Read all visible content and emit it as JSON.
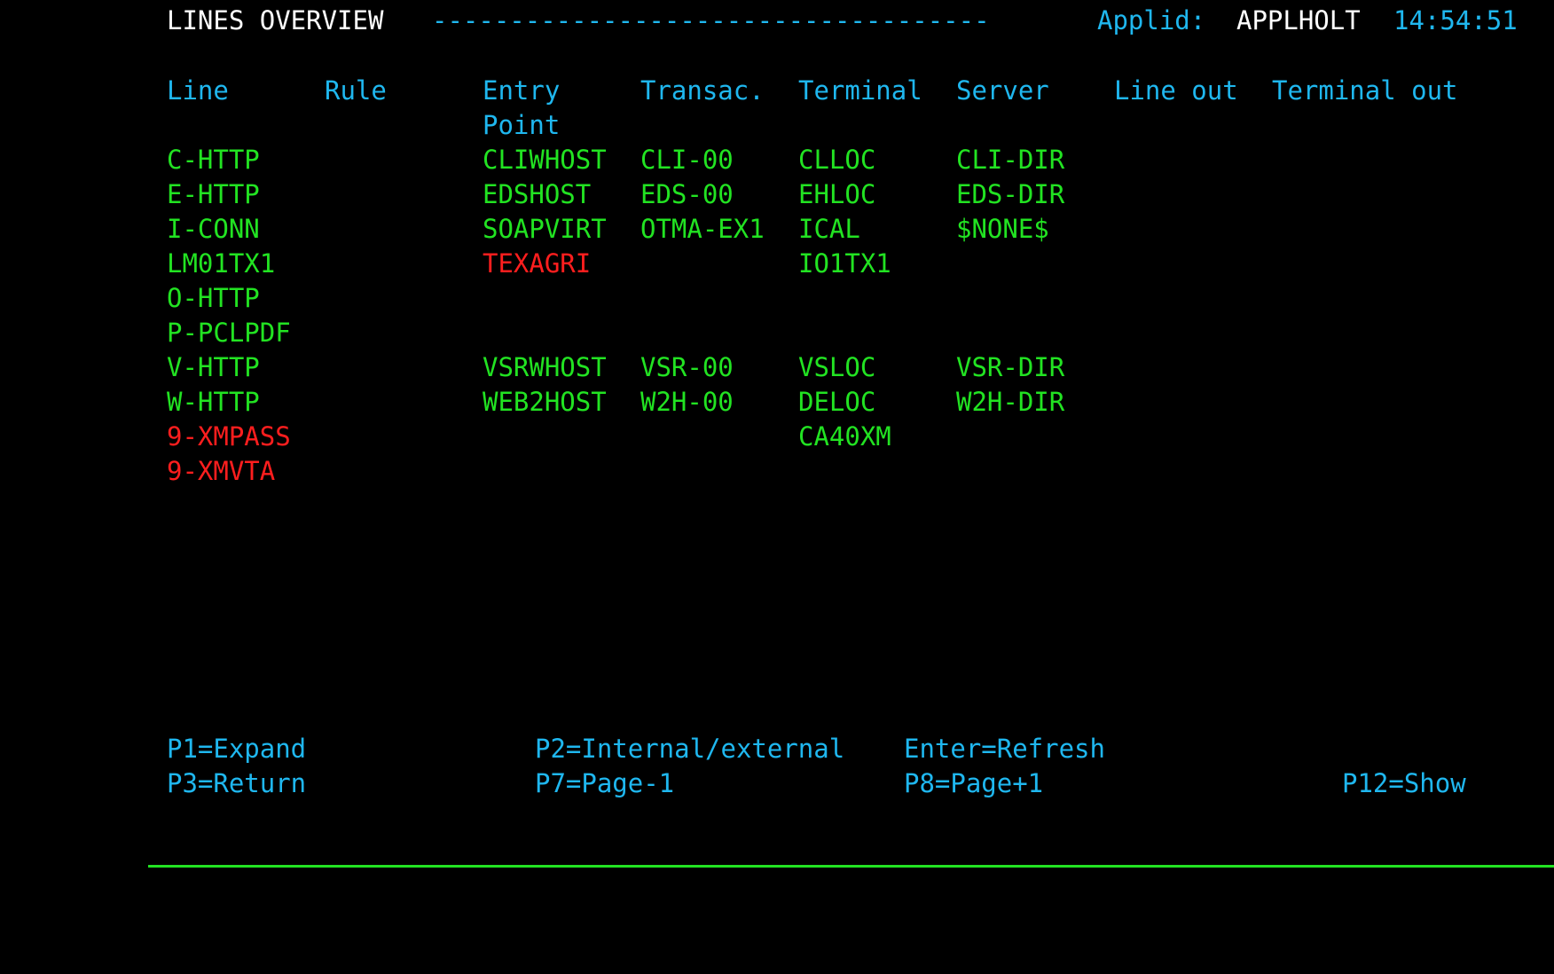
{
  "header": {
    "title": "LINES OVERVIEW",
    "dashes": "------------------------------------",
    "applid_label": "Applid:",
    "applid_value": "APPLHOLT",
    "time": "14:54:51"
  },
  "columns": {
    "line": "Line",
    "rule": "Rule",
    "entry": "Entry",
    "entry_2": "Point",
    "transac": "Transac.",
    "terminal": "Terminal",
    "server": "Server",
    "line_out": "Line out",
    "terminal_out": "Terminal out"
  },
  "rows": [
    {
      "line": "C-HTTP",
      "entry": "CLIWHOST",
      "transac": "CLI-00",
      "terminal": "CLLOC",
      "server": "CLI-DIR"
    },
    {
      "line": "E-HTTP",
      "entry": "EDSHOST",
      "transac": "EDS-00",
      "terminal": "EHLOC",
      "server": "EDS-DIR"
    },
    {
      "line": "I-CONN",
      "entry": "SOAPVIRT",
      "transac": "OTMA-EX1",
      "terminal": "ICAL",
      "server": "$NONE$"
    },
    {
      "line": "LM01TX1",
      "entry": "TEXAGRI",
      "transac": "",
      "terminal": "IO1TX1",
      "server": ""
    },
    {
      "line": "O-HTTP",
      "entry": "",
      "transac": "",
      "terminal": "",
      "server": ""
    },
    {
      "line": "P-PCLPDF",
      "entry": "",
      "transac": "",
      "terminal": "",
      "server": ""
    },
    {
      "line": "V-HTTP",
      "entry": "VSRWHOST",
      "transac": "VSR-00",
      "terminal": "VSLOC",
      "server": "VSR-DIR"
    },
    {
      "line": "W-HTTP",
      "entry": "WEB2HOST",
      "transac": "W2H-00",
      "terminal": "DELOC",
      "server": "W2H-DIR"
    },
    {
      "line": "9-XMPASS",
      "entry": "",
      "transac": "",
      "terminal": "CA40XM",
      "server": ""
    },
    {
      "line": "9-XMVTA",
      "entry": "",
      "transac": "",
      "terminal": "",
      "server": ""
    }
  ],
  "pf_keys": {
    "p1": "P1=Expand",
    "p2": "P2=Internal/external",
    "enter": "Enter=Refresh",
    "p3": "P3=Return",
    "p7": "P7=Page-1",
    "p8": "P8=Page+1",
    "p12": "P12=Show"
  },
  "colors": {
    "background": "#000000",
    "label": "#1fb7ef",
    "value": "#22e322",
    "error": "#ff1e1e",
    "highlight": "#ffffff"
  }
}
